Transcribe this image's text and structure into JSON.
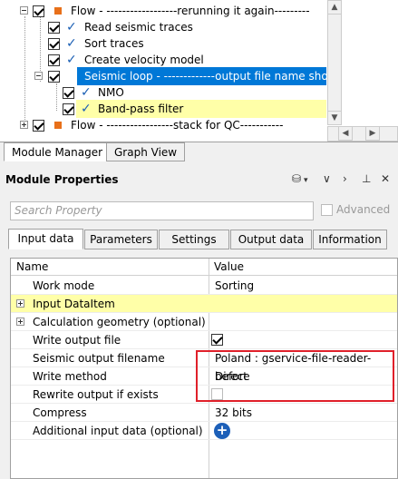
{
  "tree": {
    "rows": [
      {
        "label": "Flow - ------------------rerunning it again---------",
        "kind": "flow"
      },
      {
        "label": "Read seismic traces",
        "kind": "module"
      },
      {
        "label": "Sort traces",
        "kind": "module"
      },
      {
        "label": "Create velocity model",
        "kind": "module"
      },
      {
        "label": "Seismic loop - -------------output file name sho...",
        "kind": "loop"
      },
      {
        "label": "NMO",
        "kind": "module"
      },
      {
        "label": "Band-pass filter",
        "kind": "module"
      },
      {
        "label": "Flow - -----------------stack for QC-----------",
        "kind": "flow"
      }
    ]
  },
  "bottom_tabs": [
    "Module Manager",
    "Graph View"
  ],
  "module_properties": {
    "title": "Module Properties",
    "search_placeholder": "Search Property",
    "advanced_label": "Advanced",
    "tabs": [
      "Input data",
      "Parameters",
      "Settings",
      "Output data",
      "Information"
    ],
    "columns": {
      "name": "Name",
      "value": "Value"
    },
    "rows": [
      {
        "name": "Work mode",
        "value": "Sorting"
      },
      {
        "name": "Input DataItem",
        "value": ""
      },
      {
        "name": "Calculation geometry (optional)",
        "value": ""
      },
      {
        "name": "Write output file",
        "value": ""
      },
      {
        "name": "Seismic output filename",
        "value": "Poland : gservice-file-reader-before"
      },
      {
        "name": "Write method",
        "value": "Direct"
      },
      {
        "name": "Rewrite output if exists",
        "value": ""
      },
      {
        "name": "Compress",
        "value": "32 bits"
      },
      {
        "name": "Additional input data (optional)",
        "value": ""
      }
    ]
  },
  "colors": {
    "selection": "#0078d7",
    "highlight": "#ffffa8",
    "accent": "#e8701a",
    "annotation": "#e0202a"
  }
}
